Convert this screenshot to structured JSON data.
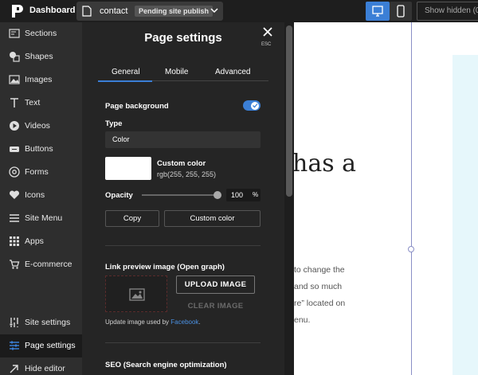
{
  "topbar": {
    "app_title": "Dashboard",
    "page_name": "contact",
    "status_badge": "Pending site publish",
    "show_hidden": "Show hidden (0"
  },
  "sidebar": {
    "items": [
      {
        "label": "Sections",
        "icon": "sections-icon"
      },
      {
        "label": "Shapes",
        "icon": "shapes-icon"
      },
      {
        "label": "Images",
        "icon": "image-icon"
      },
      {
        "label": "Text",
        "icon": "text-icon"
      },
      {
        "label": "Videos",
        "icon": "play-icon"
      },
      {
        "label": "Buttons",
        "icon": "button-icon"
      },
      {
        "label": "Forms",
        "icon": "at-icon"
      },
      {
        "label": "Icons",
        "icon": "heart-icon"
      },
      {
        "label": "Site Menu",
        "icon": "menu-icon"
      },
      {
        "label": "Apps",
        "icon": "grid-icon"
      },
      {
        "label": "E-commerce",
        "icon": "cart-icon"
      }
    ],
    "bottom": [
      {
        "label": "Site settings",
        "icon": "site-settings-icon"
      },
      {
        "label": "Page settings",
        "icon": "sliders-icon",
        "active": true
      },
      {
        "label": "Hide editor",
        "icon": "arrow-icon"
      }
    ]
  },
  "panel": {
    "title": "Page settings",
    "esc_label": "ESC",
    "tabs": [
      "General",
      "Mobile",
      "Advanced"
    ],
    "active_tab": "General",
    "page_background_label": "Page background",
    "page_background_enabled": true,
    "type_label": "Type",
    "type_value": "Color",
    "custom_color_title": "Custom color",
    "custom_color_value": "rgb(255, 255, 255)",
    "swatch_color": "#ffffff",
    "opacity_label": "Opacity",
    "opacity_value": "100",
    "opacity_unit": "%",
    "copy_button": "Copy",
    "custom_color_button": "Custom color",
    "link_preview_label": "Link preview image (Open graph)",
    "upload_button": "UPLOAD IMAGE",
    "clear_button": "CLEAR IMAGE",
    "update_note_prefix": "Update image used by ",
    "update_note_link": "Facebook",
    "update_note_suffix": ".",
    "seo_label": "SEO (Search engine optimization)"
  },
  "canvas": {
    "heading_fragment": "has a",
    "body_lines": [
      "to change the",
      "and so much",
      "re” located on",
      "enu."
    ]
  },
  "colors": {
    "accent": "#3b7fd6",
    "sidebar_bg": "#2e2e2e",
    "panel_bg": "#252525",
    "topbar_bg": "#1e1e1e"
  }
}
